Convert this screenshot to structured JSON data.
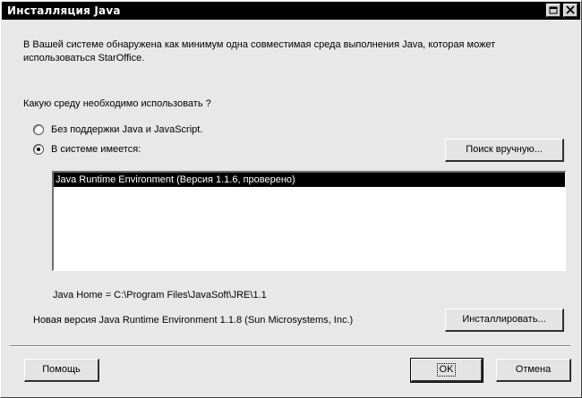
{
  "window": {
    "title": "Инсталляция Java",
    "controls": {
      "minimize": "minimize-icon",
      "close": "close-icon"
    }
  },
  "intro": "В Вашей системе обнаружена как минимум одна совместимая среда выполнения Java, которая может использоваться StarOffice.",
  "question": "Какую среду необходимо использовать ?",
  "options": {
    "no_java": {
      "label": "Без поддержки Java и JavaScript.",
      "selected": false
    },
    "installed": {
      "label": "В системе имеется:",
      "selected": true
    }
  },
  "search_button": "Поиск вручную...",
  "runtimes": [
    {
      "label": "Java Runtime Environment (Версия 1.1.6, проверено)",
      "selected": true
    }
  ],
  "java_home": "Java Home = C:\\Program Files\\JavaSoft\\JRE\\1.1",
  "new_version": "Новая версия Java Runtime Environment 1.1.8 (Sun Microsystems, Inc.)",
  "install_button": "Инсталлировать...",
  "footer": {
    "help": "Помощь",
    "ok": "OK",
    "cancel": "Отмена"
  },
  "colors": {
    "titlebar": "#000000",
    "face": "#e8e8e8",
    "selection": "#000000"
  }
}
